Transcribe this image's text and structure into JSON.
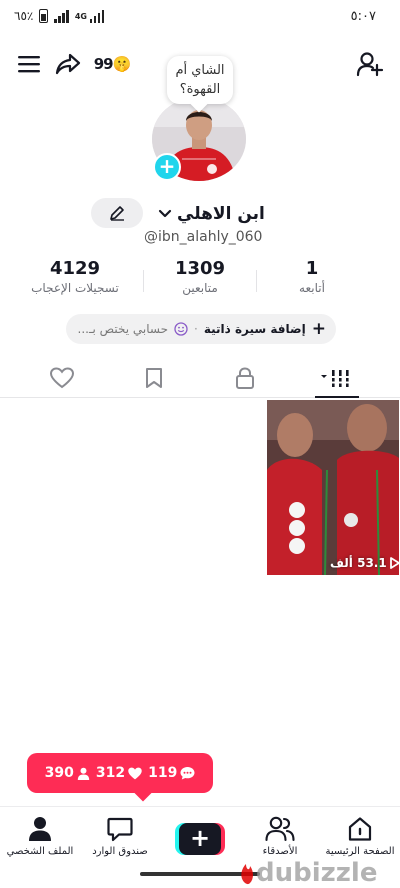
{
  "status_bar": {
    "battery": "٦٥٪",
    "network": "4G",
    "time": "٥:٠٧"
  },
  "top_bar": {
    "more_label": "99🤫"
  },
  "profile": {
    "note": "الشاي أم القهوة؟",
    "display_name": "ابن الاهلي",
    "username": "@ibn_alahly_060"
  },
  "stats": [
    {
      "value": "1",
      "label": "أتابعه"
    },
    {
      "value": "1309",
      "label": "متابعين"
    },
    {
      "value": "4129",
      "label": "تسجيلات الإعجاب"
    }
  ],
  "bio": {
    "add_label": "إضافة سيرة ذاتية",
    "hint": "حسابي يختص بـ..."
  },
  "tabs": [
    "videos",
    "private",
    "saved",
    "liked"
  ],
  "video": {
    "views": "53.1 ألف"
  },
  "notification": {
    "comments": "119",
    "likes": "312",
    "followers": "390"
  },
  "bottom_nav": {
    "home": "الصفحة الرئيسية",
    "friends": "الأصدقاء",
    "inbox": "صندوق الوارد",
    "profile": "الملف الشخصي"
  },
  "watermark": "dubizzle",
  "colors": {
    "accent": "#fe2c55",
    "cyan": "#25f4ee",
    "avatar_badge": "#20d5ec",
    "text": "#161823",
    "watermark_red": "#e00000"
  }
}
